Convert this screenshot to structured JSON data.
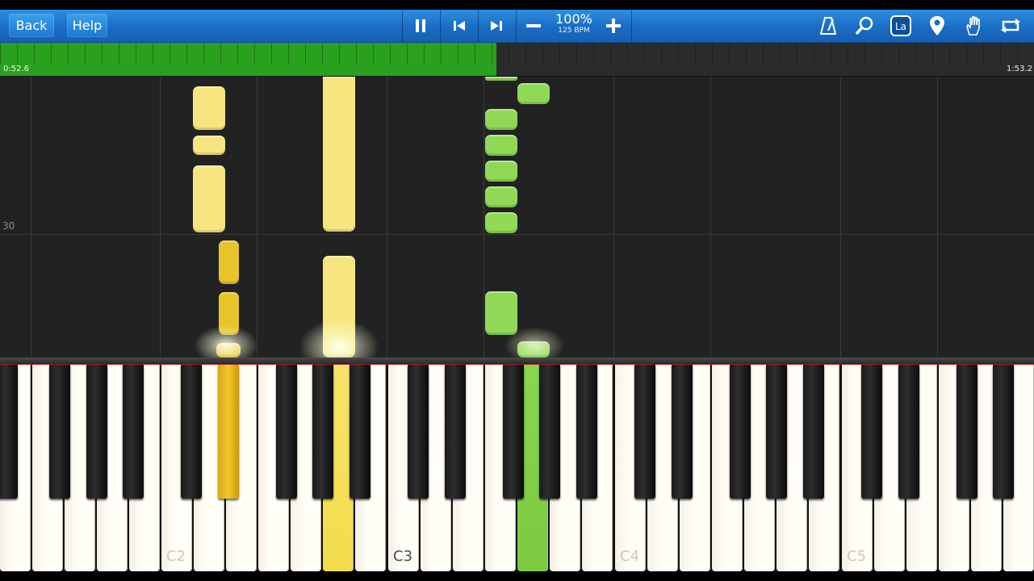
{
  "toolbar": {
    "back_label": "Back",
    "help_label": "Help",
    "speed_percent": "100%",
    "speed_bpm": "125 BPM",
    "icons": [
      "pause-icon",
      "skip-back-icon",
      "skip-forward-icon",
      "slower-minus-icon",
      "faster-plus-icon",
      "metronome-icon",
      "zoom-icon",
      "note-labels-icon",
      "marker-icon",
      "hand-icon",
      "loop-icon"
    ]
  },
  "progress": {
    "elapsed": "0:52.6",
    "total": "1:53.2",
    "fraction": 0.48
  },
  "roll": {
    "measure_number": "30"
  },
  "keyboard": {
    "octave_labels": [
      "C2",
      "C3",
      "C4",
      "C5"
    ],
    "active_key_colors": {
      "left_hand": "#e9c32a",
      "light_yellow": "#f7e680",
      "right_hand": "#8fd957"
    }
  },
  "colors": {
    "toolbar_blue": "#1f77d0",
    "progress_green": "#2aa01f",
    "roll_background": "#222222"
  }
}
